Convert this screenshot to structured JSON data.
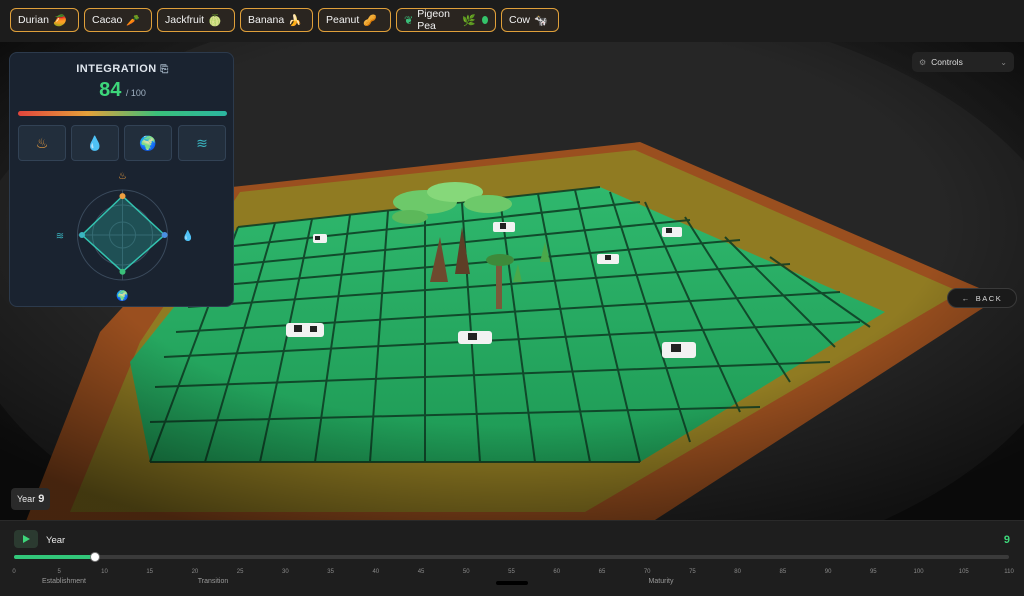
{
  "species": [
    {
      "name": "Durian",
      "emoji": "🥭",
      "dot": "#f08a2e"
    },
    {
      "name": "Cacao",
      "emoji": "🥕",
      "dot": "#f0b62e"
    },
    {
      "name": "Jackfruit",
      "emoji": "🍈",
      "dot": "#9b5ff0"
    },
    {
      "name": "Banana",
      "emoji": "🍌",
      "dot": "#34c36a"
    },
    {
      "name": "Peanut",
      "emoji": "🥜",
      "dot": "#34c36a"
    },
    {
      "name": "Pigeon Pea",
      "emoji": "🌿",
      "dot": "#34c36a"
    },
    {
      "name": "Cow",
      "emoji": "🐄",
      "dot": "#34c36a"
    }
  ],
  "integration": {
    "title": "INTEGRATION",
    "score": "84",
    "max": "/ 100",
    "axes": {
      "fire": 0.72,
      "water": 0.78,
      "earth": 0.68,
      "air": 0.75
    }
  },
  "controls": {
    "label": "Controls"
  },
  "back": {
    "label": "BACK"
  },
  "year_badge": {
    "label": "Year",
    "value": "9"
  },
  "timeline": {
    "label": "Year",
    "value": "9",
    "current": 9,
    "min": 0,
    "max": 110,
    "ticks": [
      "0",
      "5",
      "10",
      "15",
      "20",
      "25",
      "30",
      "35",
      "40",
      "45",
      "50",
      "55",
      "60",
      "65",
      "70",
      "75",
      "80",
      "85",
      "90",
      "95",
      "100",
      "105",
      "110"
    ],
    "phases": [
      "Establishment",
      "Transition",
      "Maturity"
    ]
  },
  "colors": {
    "accent": "#3dd67a",
    "chip_border": "#e0a03a",
    "field_green": "#1f9a5a",
    "field_orange": "#b5601f"
  }
}
